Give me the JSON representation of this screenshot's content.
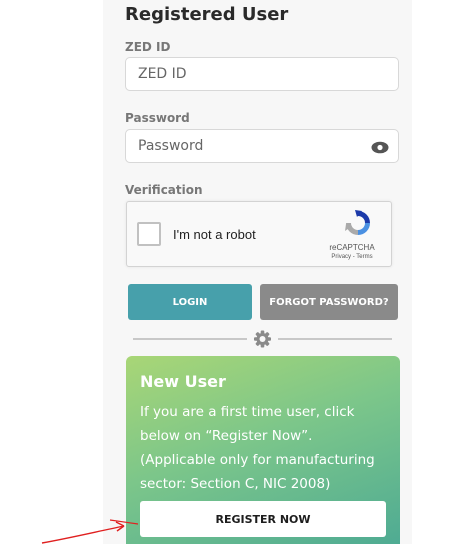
{
  "login": {
    "heading": "Registered User",
    "zed_id_label": "ZED ID",
    "zed_id_placeholder": "ZED ID",
    "password_label": "Password",
    "password_placeholder": "Password",
    "verification_label": "Verification",
    "login_button": "LOGIN",
    "forgot_button": "FORGOT PASSWORD?"
  },
  "captcha": {
    "checkbox_label": "I'm not a robot",
    "brand": "reCAPTCHA",
    "terms": "Privacy - Terms"
  },
  "new_user": {
    "title": "New User",
    "text": "If you are a first time user, click below on “Register Now”. (Applicable only for manufacturing sector: Section C, NIC 2008)",
    "register_button": "REGISTER NOW"
  },
  "colors": {
    "login_button": "#47a0ab",
    "forgot_button": "#8a8a8a",
    "gradient_top": "#a9d676",
    "gradient_bottom": "#4fab93",
    "annotation_arrow": "#e02020"
  },
  "icons": [
    "eye-icon",
    "recaptcha-logo-icon",
    "gear-icon",
    "annotation-arrow-icon"
  ]
}
